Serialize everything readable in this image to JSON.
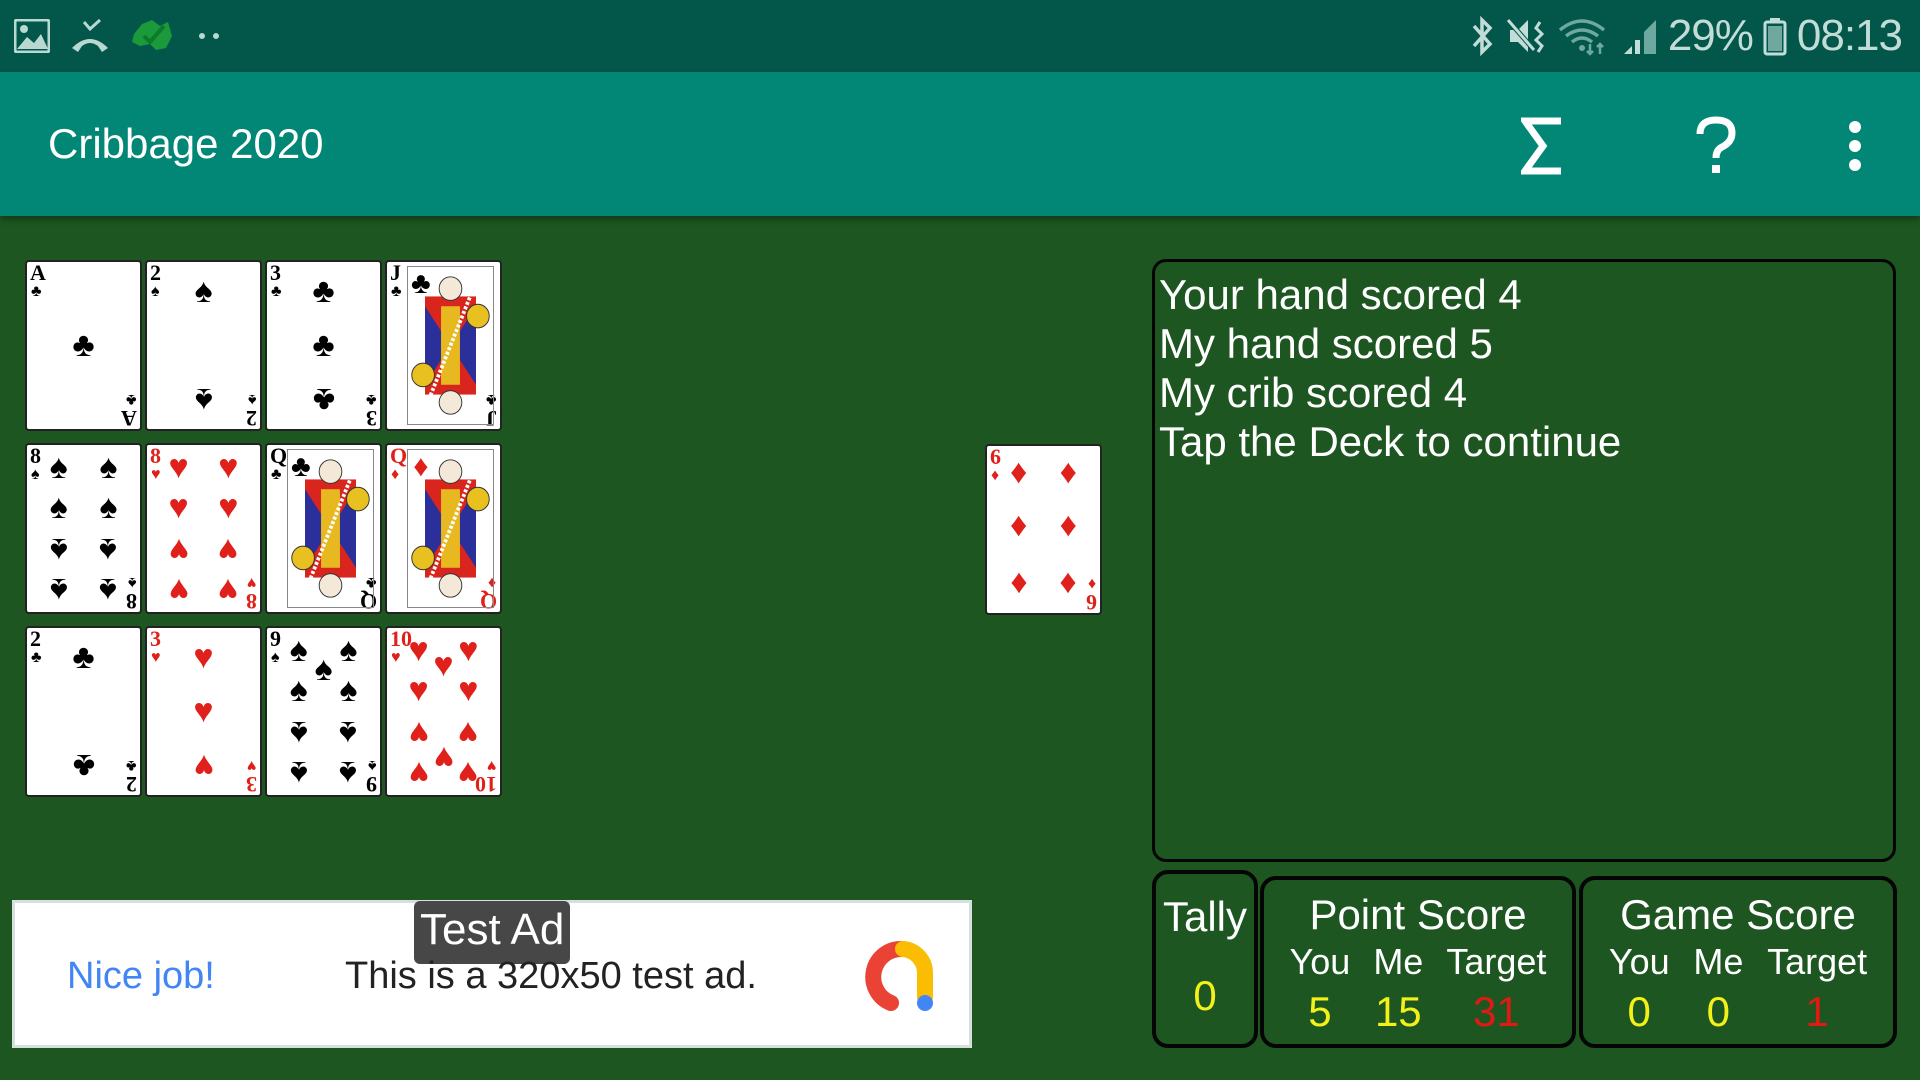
{
  "status_bar": {
    "left_icons": [
      "gallery-icon",
      "missed-call-icon",
      "australia-check-icon",
      "more-notifications-icon"
    ],
    "right_icons": [
      "bluetooth-icon",
      "vibrate-icon",
      "wifi-icon",
      "signal-icon"
    ],
    "battery": "29%",
    "time": "08:13"
  },
  "app_bar": {
    "title": "Cribbage 2020",
    "actions": [
      {
        "name": "sigma-icon",
        "glyph": "Σ"
      },
      {
        "name": "help-icon",
        "glyph": "?"
      },
      {
        "name": "overflow-menu-icon",
        "glyph": "⋮"
      }
    ]
  },
  "hands": {
    "rows": [
      [
        {
          "rank": "A",
          "suit": "♣",
          "color": "black"
        },
        {
          "rank": "2",
          "suit": "♠",
          "color": "black"
        },
        {
          "rank": "3",
          "suit": "♣",
          "color": "black"
        },
        {
          "rank": "J",
          "suit": "♣",
          "color": "black",
          "face": true
        }
      ],
      [
        {
          "rank": "8",
          "suit": "♠",
          "color": "black"
        },
        {
          "rank": "8",
          "suit": "♥",
          "color": "red"
        },
        {
          "rank": "Q",
          "suit": "♣",
          "color": "black",
          "face": true
        },
        {
          "rank": "Q",
          "suit": "♦",
          "color": "red",
          "face": true
        }
      ],
      [
        {
          "rank": "2",
          "suit": "♣",
          "color": "black"
        },
        {
          "rank": "3",
          "suit": "♥",
          "color": "red"
        },
        {
          "rank": "9",
          "suit": "♠",
          "color": "black"
        },
        {
          "rank": "10",
          "suit": "♥",
          "color": "red"
        }
      ]
    ]
  },
  "starter_card": {
    "rank": "6",
    "suit": "♦",
    "color": "red"
  },
  "messages": [
    "Your hand scored 4",
    "My hand scored 5",
    "My crib scored 4",
    "Tap the Deck to continue"
  ],
  "tally": {
    "label": "Tally",
    "value": "0"
  },
  "point_score": {
    "title": "Point Score",
    "headers": [
      "You",
      "Me",
      "Target"
    ],
    "values": [
      "5",
      "15",
      "31"
    ]
  },
  "game_score": {
    "title": "Game Score",
    "headers": [
      "You",
      "Me",
      "Target"
    ],
    "values": [
      "0",
      "0",
      "1"
    ]
  },
  "ad": {
    "badge": "Test Ad",
    "headline": "Nice job!",
    "body": "This is a 320x50 test ad.",
    "logo_colors": [
      "#ea4335",
      "#fbbc04",
      "#4285f4"
    ]
  },
  "colors": {
    "status_bar": "#02564a",
    "app_bar": "#028675",
    "table_felt": "#1d5620",
    "score_yellow": "#f2f21a",
    "score_red": "#e01a12"
  }
}
